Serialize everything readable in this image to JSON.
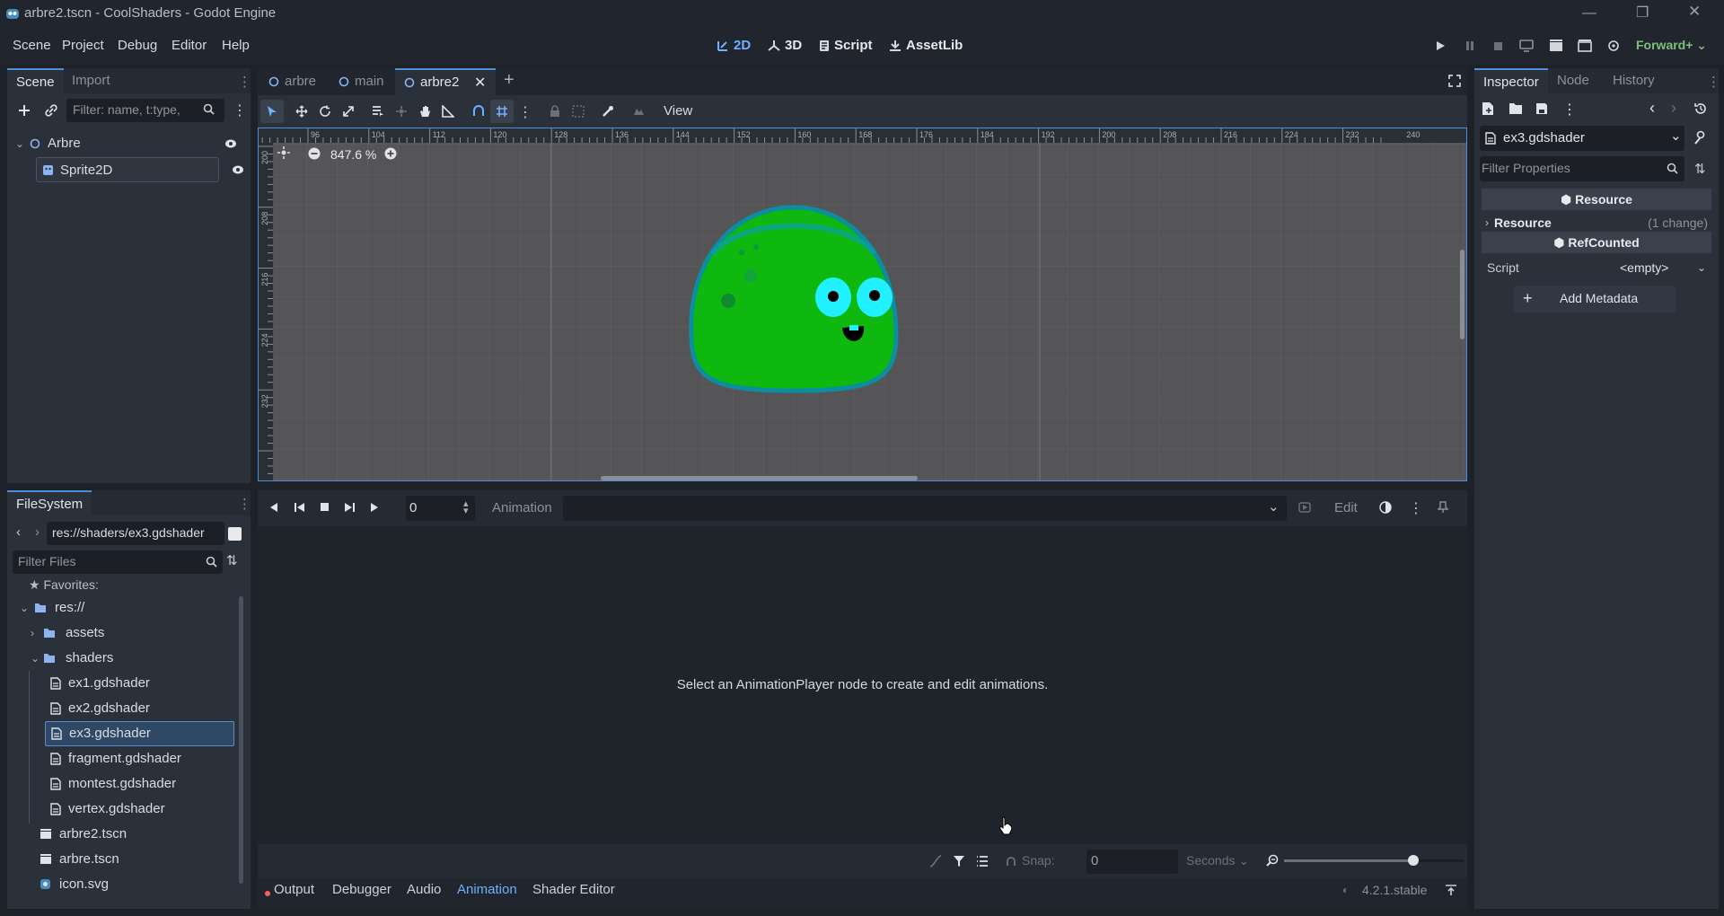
{
  "window": {
    "title": "arbre2.tscn - CoolShaders - Godot Engine"
  },
  "menu": {
    "items": [
      "Scene",
      "Project",
      "Debug",
      "Editor",
      "Help"
    ]
  },
  "workspaces": {
    "items": [
      "2D",
      "3D",
      "Script",
      "AssetLib"
    ],
    "active": "2D"
  },
  "renderer": {
    "label": "Forward+"
  },
  "scene_dock": {
    "tabs": [
      "Scene",
      "Import"
    ],
    "filter_placeholder": "Filter: name, t:type,",
    "nodes": [
      {
        "name": "Arbre"
      },
      {
        "name": "Sprite2D"
      }
    ]
  },
  "filesystem_dock": {
    "tab": "FileSystem",
    "path": "res://shaders/ex3.gdshader",
    "filter_placeholder": "Filter Files",
    "favorites": "Favorites:",
    "root": "res://",
    "folders": [
      "assets",
      "shaders"
    ],
    "shader_files": [
      "ex1.gdshader",
      "ex2.gdshader",
      "ex3.gdshader",
      "fragment.gdshader",
      "montest.gdshader",
      "vertex.gdshader"
    ],
    "root_files": [
      "arbre2.tscn",
      "arbre.tscn",
      "icon.svg"
    ],
    "selected": "ex3.gdshader"
  },
  "editor_tabs": {
    "items": [
      "arbre",
      "main",
      "arbre2"
    ],
    "active": "arbre2"
  },
  "toolbar_2d": {
    "view_label": "View"
  },
  "viewport": {
    "zoom_label": "847.6 %",
    "ruler_ticks": [
      "96",
      "104",
      "112",
      "120",
      "128",
      "136",
      "144",
      "152",
      "160",
      "168",
      "176",
      "184",
      "192",
      "200",
      "208",
      "216",
      "224",
      "232",
      "240"
    ],
    "vertical_ticks": [
      "200",
      "208",
      "216",
      "224",
      "232"
    ]
  },
  "animation_panel": {
    "time_value": "0",
    "animation_label": "Animation",
    "edit_label": "Edit",
    "empty_message": "Select an AnimationPlayer node to create and edit animations.",
    "snap_label": "Snap:",
    "snap_value": "0",
    "unit": "Seconds",
    "zoom_level": 0.72
  },
  "bottom_tabs": {
    "items": [
      "Output",
      "Debugger",
      "Audio",
      "Animation",
      "Shader Editor"
    ],
    "active": "Animation"
  },
  "version": "4.2.1.stable",
  "inspector": {
    "tabs": [
      "Inspector",
      "Node",
      "History"
    ],
    "resource_name": "ex3.gdshader",
    "filter_placeholder": "Filter Properties",
    "section_resource": "Resource",
    "resource_group": "Resource",
    "resource_changes": "(1 change)",
    "section_refcounted": "RefCounted",
    "script_label": "Script",
    "script_value": "<empty>",
    "add_metadata": "Add Metadata"
  },
  "colors": {
    "accent": "#4c8fdb",
    "blob_green": "#0fb80f",
    "blob_outline": "#0a8ea0",
    "eye_cyan": "#20f0ff",
    "background": "#1d2229"
  }
}
